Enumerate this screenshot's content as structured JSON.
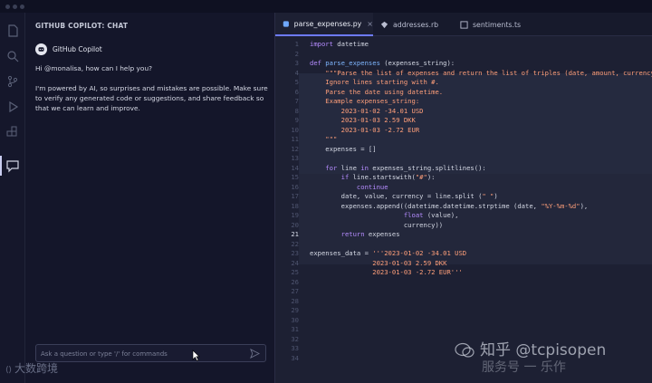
{
  "chat": {
    "title": "GITHUB COPILOT: CHAT",
    "bot_name": "GitHub Copilot",
    "greeting": "Hi @monalisa, how can I help you?",
    "disclaimer": "I'm powered by AI, so surprises and mistakes are possible. Make sure to verify any generated code or suggestions, and share feedback so that we can learn and improve.",
    "input_placeholder": "Ask a question or type '/' for commands"
  },
  "tabs": [
    {
      "label": "parse_expenses.py",
      "active": true,
      "close": "×"
    },
    {
      "label": "addresses.rb",
      "active": false
    },
    {
      "label": "sentiments.ts",
      "active": false
    }
  ],
  "editor": {
    "current_line": 21,
    "line_numbers": [
      "1",
      "2",
      "3",
      "4",
      "5",
      "6",
      "7",
      "8",
      "9",
      "10",
      "11",
      "12",
      "13",
      "14",
      "15",
      "16",
      "17",
      "18",
      "19",
      "20",
      "21",
      "22",
      "23",
      "24",
      "25",
      "26",
      "27",
      "28",
      "29",
      "30",
      "31",
      "32",
      "33",
      "34"
    ]
  },
  "code": {
    "l1_kw": "import",
    "l1_rest": " datetime",
    "l3_kw": "def",
    "l3_fn": " parse_expenses",
    "l3_rest": " (expenses_string):",
    "l4": "    \"\"\"Parse the list of expenses and return the list of triples (date, amount, currency",
    "l5": "    Ignore lines starting with #.",
    "l6": "    Parse the date using datetime.",
    "l7": "    Example expenses_string:",
    "l8": "        2023-01-02 -34.01 USD",
    "l9": "        2023-01-03 2.59 DKK",
    "l10": "        2023-01-03 -2.72 EUR",
    "l11": "    \"\"\"",
    "l12": "    expenses = []",
    "l14_kw": "    for",
    "l14_rest": " line",
    "l14_kw2": " in",
    "l14_rest2": " expenses_string.splitlines():",
    "l15_kw": "        if",
    "l15_rest": " line.startswith(",
    "l15_str": "\"#\"",
    "l15_end": "):",
    "l16_kw": "            continue",
    "l17_a": "        date, value, currency = line.split (",
    "l17_str": "\" \"",
    "l17_end": ")",
    "l18_a": "        expenses.append((datetime.datetime.strptime (date, ",
    "l18_str": "\"%Y-%m-%d\"",
    "l18_end": "),",
    "l19_kw": "                        float",
    "l19_rest": " (value),",
    "l20": "                        currency))",
    "l21_kw": "        return",
    "l21_rest": " expenses",
    "l23_a": "expenses_data = ",
    "l23_str": "'''2023-01-02 -34.01 USD",
    "l24_str": "                2023-01-03 2.59 DKK",
    "l25_str": "                2023-01-03 -2.72 EUR'''"
  },
  "watermark": "知乎 @tcpisopen",
  "watermark_sub": "服务号 一 乐作",
  "footer_logo": "大数跨境"
}
